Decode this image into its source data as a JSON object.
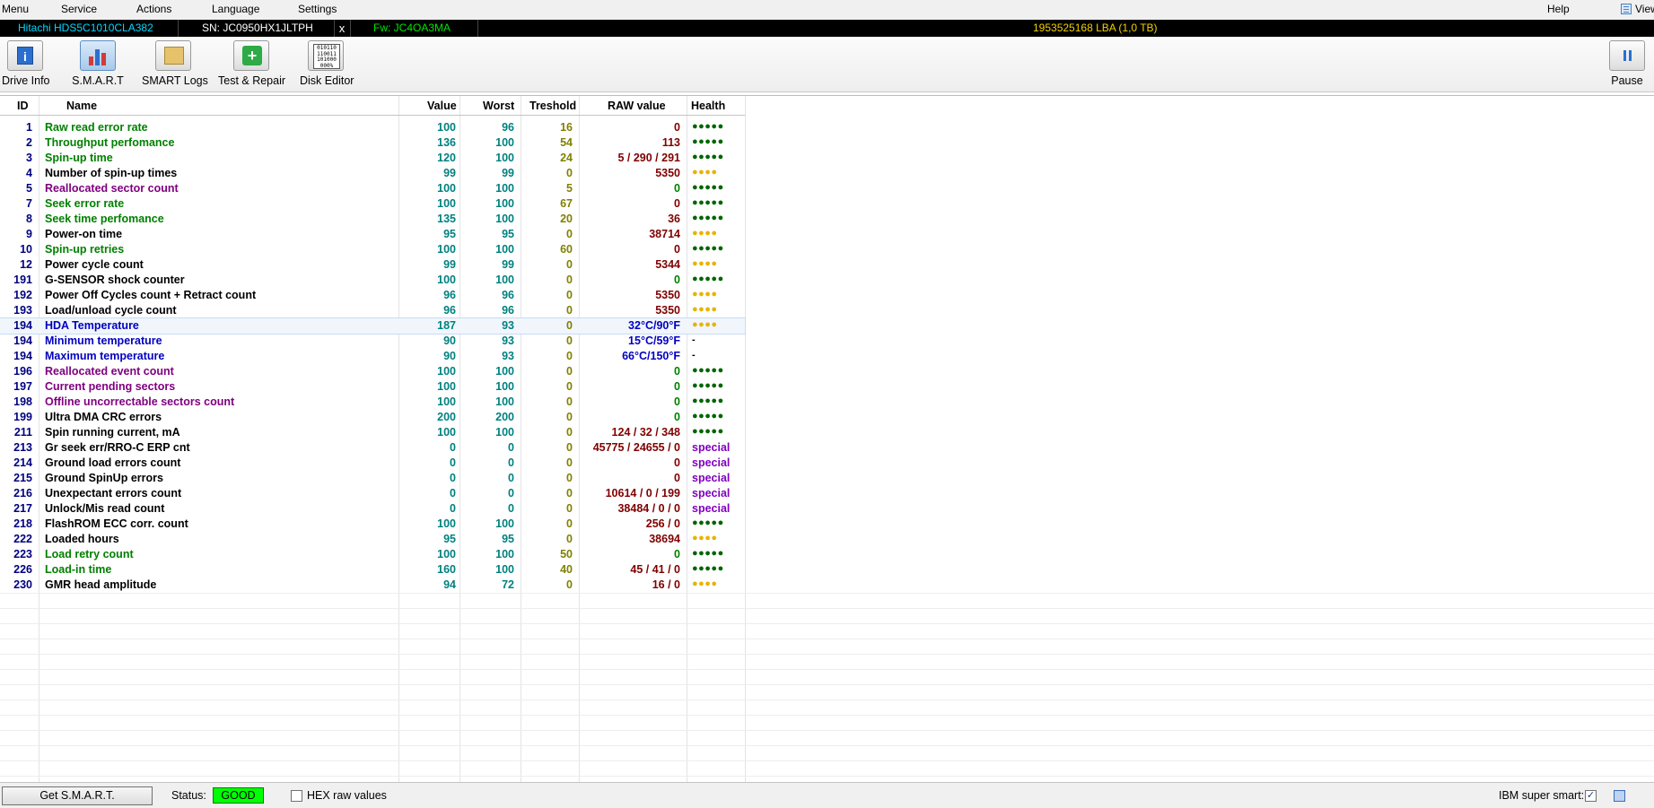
{
  "menu": {
    "items": [
      "Menu",
      "Service",
      "Actions",
      "Language",
      "Settings"
    ],
    "help": "Help",
    "view": "View"
  },
  "infobar": {
    "model": "Hitachi HDS5C1010CLA382",
    "serial": "SN: JC0950HX1JLTPH",
    "close": "x",
    "firmware": "Fw: JC4OA3MA",
    "capacity": "1953525168 LBA (1,0 TB)"
  },
  "toolbar": {
    "drive_info": "Drive Info",
    "smart": "S.M.A.R.T",
    "smart_logs": "SMART Logs",
    "test_repair": "Test & Repair",
    "disk_editor": "Disk Editor",
    "pause": "Pause",
    "disk_editor_glyph": "010110 110011 101000 000%"
  },
  "table": {
    "headers": {
      "id": "ID",
      "name": "Name",
      "value": "Value",
      "worst": "Worst",
      "treshold": "Treshold",
      "raw": "RAW value",
      "health": "Health"
    },
    "rows": [
      {
        "id": "1",
        "name": "Raw read error rate",
        "value": "100",
        "worst": "96",
        "treshold": "16",
        "raw": "0",
        "health": "●●●●●",
        "name_color": "#008000",
        "health_color": "#006400",
        "raw_color": "#800000"
      },
      {
        "id": "2",
        "name": "Throughput perfomance",
        "value": "136",
        "worst": "100",
        "treshold": "54",
        "raw": "113",
        "health": "●●●●●",
        "name_color": "#008000",
        "health_color": "#006400",
        "raw_color": "#800000"
      },
      {
        "id": "3",
        "name": "Spin-up time",
        "value": "120",
        "worst": "100",
        "treshold": "24",
        "raw": "5 / 290 / 291",
        "health": "●●●●●",
        "name_color": "#008000",
        "health_color": "#006400",
        "raw_color": "#800000"
      },
      {
        "id": "4",
        "name": "Number of spin-up times",
        "value": "99",
        "worst": "99",
        "treshold": "0",
        "raw": "5350",
        "health": "●●●●",
        "name_color": "#000000",
        "health_color": "#e8b400",
        "raw_color": "#800000"
      },
      {
        "id": "5",
        "name": "Reallocated sector count",
        "value": "100",
        "worst": "100",
        "treshold": "5",
        "raw": "0",
        "health": "●●●●●",
        "name_color": "#800080",
        "health_color": "#006400",
        "raw_color": "#008000"
      },
      {
        "id": "7",
        "name": "Seek error rate",
        "value": "100",
        "worst": "100",
        "treshold": "67",
        "raw": "0",
        "health": "●●●●●",
        "name_color": "#008000",
        "health_color": "#006400",
        "raw_color": "#800000"
      },
      {
        "id": "8",
        "name": "Seek time perfomance",
        "value": "135",
        "worst": "100",
        "treshold": "20",
        "raw": "36",
        "health": "●●●●●",
        "name_color": "#008000",
        "health_color": "#006400",
        "raw_color": "#800000"
      },
      {
        "id": "9",
        "name": "Power-on time",
        "value": "95",
        "worst": "95",
        "treshold": "0",
        "raw": "38714",
        "health": "●●●●",
        "name_color": "#000000",
        "health_color": "#e8b400",
        "raw_color": "#800000"
      },
      {
        "id": "10",
        "name": "Spin-up retries",
        "value": "100",
        "worst": "100",
        "treshold": "60",
        "raw": "0",
        "health": "●●●●●",
        "name_color": "#008000",
        "health_color": "#006400",
        "raw_color": "#800000"
      },
      {
        "id": "12",
        "name": "Power cycle count",
        "value": "99",
        "worst": "99",
        "treshold": "0",
        "raw": "5344",
        "health": "●●●●",
        "name_color": "#000000",
        "health_color": "#e8b400",
        "raw_color": "#800000"
      },
      {
        "id": "191",
        "name": "G-SENSOR shock counter",
        "value": "100",
        "worst": "100",
        "treshold": "0",
        "raw": "0",
        "health": "●●●●●",
        "name_color": "#000000",
        "health_color": "#006400",
        "raw_color": "#008000"
      },
      {
        "id": "192",
        "name": "Power Off Cycles count + Retract count",
        "value": "96",
        "worst": "96",
        "treshold": "0",
        "raw": "5350",
        "health": "●●●●",
        "name_color": "#000000",
        "health_color": "#e8b400",
        "raw_color": "#800000"
      },
      {
        "id": "193",
        "name": "Load/unload cycle count",
        "value": "96",
        "worst": "96",
        "treshold": "0",
        "raw": "5350",
        "health": "●●●●",
        "name_color": "#000000",
        "health_color": "#e8b400",
        "raw_color": "#800000"
      },
      {
        "id": "194",
        "name": "HDA Temperature",
        "value": "187",
        "worst": "93",
        "treshold": "0",
        "raw": "32°C/90°F",
        "health": "●●●●",
        "name_color": "#0000c0",
        "health_color": "#e8b400",
        "raw_color": "#0000c0"
      },
      {
        "id": "194",
        "name": "Minimum temperature",
        "value": "90",
        "worst": "93",
        "treshold": "0",
        "raw": "15°C/59°F",
        "health": "-",
        "name_color": "#0000c0",
        "health_color": "#000000",
        "raw_color": "#0000c0"
      },
      {
        "id": "194",
        "name": "Maximum temperature",
        "value": "90",
        "worst": "93",
        "treshold": "0",
        "raw": "66°C/150°F",
        "health": "-",
        "name_color": "#0000c0",
        "health_color": "#000000",
        "raw_color": "#0000c0"
      },
      {
        "id": "196",
        "name": "Reallocated event count",
        "value": "100",
        "worst": "100",
        "treshold": "0",
        "raw": "0",
        "health": "●●●●●",
        "name_color": "#800080",
        "health_color": "#006400",
        "raw_color": "#008000"
      },
      {
        "id": "197",
        "name": "Current pending sectors",
        "value": "100",
        "worst": "100",
        "treshold": "0",
        "raw": "0",
        "health": "●●●●●",
        "name_color": "#800080",
        "health_color": "#006400",
        "raw_color": "#008000"
      },
      {
        "id": "198",
        "name": "Offline uncorrectable sectors count",
        "value": "100",
        "worst": "100",
        "treshold": "0",
        "raw": "0",
        "health": "●●●●●",
        "name_color": "#800080",
        "health_color": "#006400",
        "raw_color": "#008000"
      },
      {
        "id": "199",
        "name": "Ultra DMA CRC errors",
        "value": "200",
        "worst": "200",
        "treshold": "0",
        "raw": "0",
        "health": "●●●●●",
        "name_color": "#000000",
        "health_color": "#006400",
        "raw_color": "#008000"
      },
      {
        "id": "211",
        "name": "Spin running current, mA",
        "value": "100",
        "worst": "100",
        "treshold": "0",
        "raw": "124 / 32 / 348",
        "health": "●●●●●",
        "name_color": "#000000",
        "health_color": "#006400",
        "raw_color": "#800000"
      },
      {
        "id": "213",
        "name": "Gr seek err/RRO-C ERP cnt",
        "value": "0",
        "worst": "0",
        "treshold": "0",
        "raw": "45775 / 24655 / 0",
        "health": "special",
        "name_color": "#000000",
        "health_color": "#8000c0",
        "raw_color": "#800000"
      },
      {
        "id": "214",
        "name": "Ground load errors count",
        "value": "0",
        "worst": "0",
        "treshold": "0",
        "raw": "0",
        "health": "special",
        "name_color": "#000000",
        "health_color": "#8000c0",
        "raw_color": "#800000"
      },
      {
        "id": "215",
        "name": "Ground SpinUp errors",
        "value": "0",
        "worst": "0",
        "treshold": "0",
        "raw": "0",
        "health": "special",
        "name_color": "#000000",
        "health_color": "#8000c0",
        "raw_color": "#800000"
      },
      {
        "id": "216",
        "name": "Unexpectant errors count",
        "value": "0",
        "worst": "0",
        "treshold": "0",
        "raw": "10614 / 0 / 199",
        "health": "special",
        "name_color": "#000000",
        "health_color": "#8000c0",
        "raw_color": "#800000"
      },
      {
        "id": "217",
        "name": "Unlock/Mis read count",
        "value": "0",
        "worst": "0",
        "treshold": "0",
        "raw": "38484 / 0 / 0",
        "health": "special",
        "name_color": "#000000",
        "health_color": "#8000c0",
        "raw_color": "#800000"
      },
      {
        "id": "218",
        "name": "FlashROM ECC corr. count",
        "value": "100",
        "worst": "100",
        "treshold": "0",
        "raw": "256 / 0",
        "health": "●●●●●",
        "name_color": "#000000",
        "health_color": "#006400",
        "raw_color": "#800000"
      },
      {
        "id": "222",
        "name": "Loaded hours",
        "value": "95",
        "worst": "95",
        "treshold": "0",
        "raw": "38694",
        "health": "●●●●",
        "name_color": "#000000",
        "health_color": "#e8b400",
        "raw_color": "#800000"
      },
      {
        "id": "223",
        "name": "Load retry count",
        "value": "100",
        "worst": "100",
        "treshold": "50",
        "raw": "0",
        "health": "●●●●●",
        "name_color": "#008000",
        "health_color": "#006400",
        "raw_color": "#008000"
      },
      {
        "id": "226",
        "name": "Load-in time",
        "value": "160",
        "worst": "100",
        "treshold": "40",
        "raw": "45 / 41 / 0",
        "health": "●●●●●",
        "name_color": "#008000",
        "health_color": "#006400",
        "raw_color": "#800000"
      },
      {
        "id": "230",
        "name": "GMR head amplitude",
        "value": "94",
        "worst": "72",
        "treshold": "0",
        "raw": "16 / 0",
        "health": "●●●●",
        "name_color": "#000000",
        "health_color": "#e8b400",
        "raw_color": "#800000"
      }
    ]
  },
  "statusbar": {
    "get_smart": "Get S.M.A.R.T.",
    "status_label": "Status:",
    "status_value": "GOOD",
    "hex_label": "HEX raw values",
    "ibm_label": "IBM super smart:",
    "ibm_checked": "✓"
  },
  "colors": {
    "status_good": "#00ff00",
    "info_model": "#00d7ff",
    "info_firmware": "#00e600",
    "info_capacity": "#f0d000"
  }
}
